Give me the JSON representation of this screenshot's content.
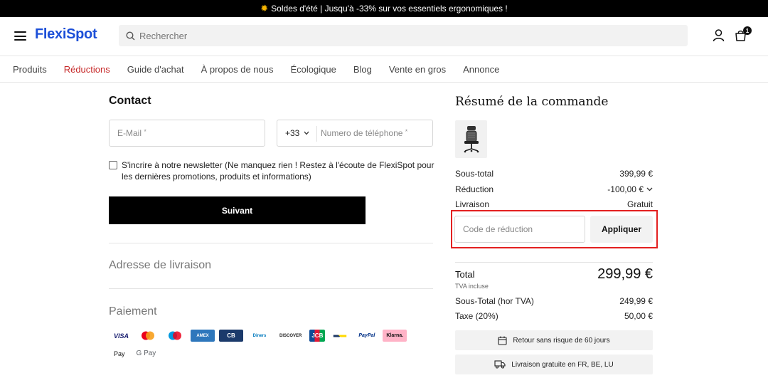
{
  "promo": {
    "icon": "sun-icon",
    "text": "Soldes d'été | Jusqu'à -33% sur vos essentiels ergonomiques !"
  },
  "header": {
    "logo": "FlexiSpot",
    "search_placeholder": "Rechercher",
    "cart_count": "1"
  },
  "nav": {
    "items": [
      "Produits",
      "Réductions",
      "Guide d'achat",
      "À propos de nous",
      "Écologique",
      "Blog",
      "Vente en gros",
      "Annonce"
    ],
    "active": "Réductions"
  },
  "contact": {
    "title": "Contact",
    "email_label": "E-Mail",
    "phone_code": "+33",
    "phone_label": "Numero de téléphone",
    "required_mark": "*",
    "newsletter_text": "S'incrire à notre newsletter (Ne manquez rien ! Restez à l'écoute de FlexiSpot pour les dernières promotions, produits et informations)",
    "newsletter_checked": false,
    "next_button": "Suivant"
  },
  "sections": {
    "shipping": "Adresse de livraison",
    "payment": "Paiement"
  },
  "payment_methods": [
    "VISA",
    "Mastercard",
    "Maestro",
    "American Express",
    "Cartes Bancaires",
    "Diners Club",
    "DISCOVER",
    "JCB",
    "Bancontact",
    "PayPal",
    "Klarna.",
    "Apple Pay",
    "G Pay"
  ],
  "summary": {
    "title": "Résumé de la commande",
    "product_icon": "office-chair-icon",
    "subtotal_label": "Sous-total",
    "subtotal_value": "399,99 €",
    "discount_label": "Réduction",
    "discount_value": "-100,00 €",
    "shipping_label": "Livraison",
    "shipping_value": "Gratuit",
    "coupon_placeholder": "Code de réduction",
    "apply_button": "Appliquer",
    "total_label": "Total",
    "total_value": "299,99 €",
    "vat_note": "TVA incluse",
    "subtotal_ht_label": "Sous-Total (hor TVA)",
    "subtotal_ht_value": "249,99 €",
    "tax_label": "Taxe (20%)",
    "tax_value": "50,00 €",
    "perk_return": "Retour sans risque de 60 jours",
    "perk_shipping": "Livraison gratuite en FR, BE, LU"
  },
  "colors": {
    "brand": "#1c4fd8",
    "active_nav": "#c62828",
    "highlight": "#e32020"
  }
}
